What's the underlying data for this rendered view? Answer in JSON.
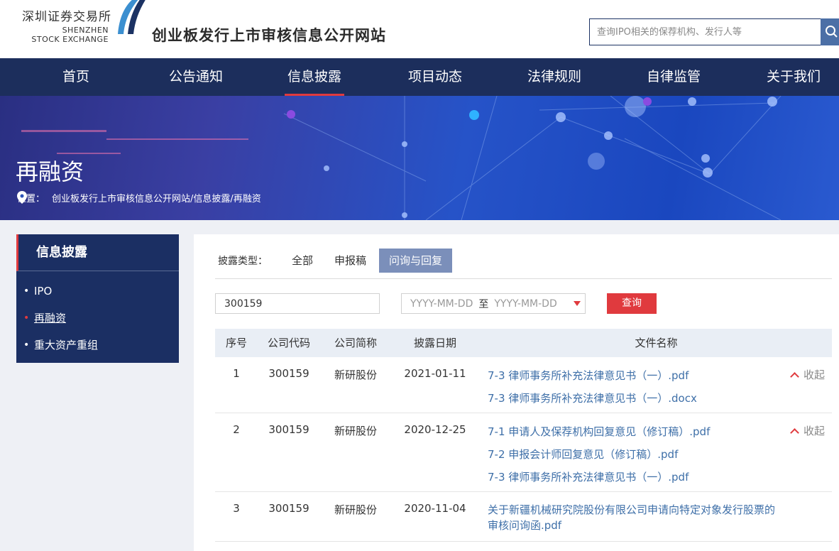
{
  "header": {
    "logo_cn": "深圳证券交易所",
    "logo_en_line1": "SHENZHEN",
    "logo_en_line2": "STOCK EXCHANGE",
    "site_title": "创业板发行上市审核信息公开网站",
    "search_placeholder": "查询IPO相关的保荐机构、发行人等",
    "search_icon": "search-icon"
  },
  "nav": {
    "items": [
      "首页",
      "公告通知",
      "信息披露",
      "项目动态",
      "法律规则",
      "自律监管",
      "关于我们"
    ],
    "active": "信息披露"
  },
  "banner": {
    "title": "再融资",
    "location_label": "位置：",
    "path": "创业板发行上市审核信息公开网站/信息披露/再融资"
  },
  "sidebar": {
    "title": "信息披露",
    "items": [
      "IPO",
      "再融资",
      "重大资产重组"
    ],
    "active": "再融资"
  },
  "filter": {
    "label": "披露类型：",
    "tabs": [
      "全部",
      "申报稿",
      "问询与回复"
    ],
    "active": "问询与回复",
    "code_value": "300159",
    "date_start_placeholder": "YYYY-MM-DD",
    "date_sep": "至",
    "date_end_placeholder": "YYYY-MM-DD",
    "query_label": "查询"
  },
  "table": {
    "headers": [
      "序号",
      "公司代码",
      "公司简称",
      "披露日期",
      "文件名称"
    ],
    "collapse_label": "收起",
    "rows": [
      {
        "no": "1",
        "code": "300159",
        "name": "新研股份",
        "date": "2021-01-11",
        "files": [
          "7-3 律师事务所补充法律意见书（一）.pdf",
          "7-3 律师事务所补充法律意见书（一）.docx"
        ],
        "collapsible": true
      },
      {
        "no": "2",
        "code": "300159",
        "name": "新研股份",
        "date": "2020-12-25",
        "files": [
          "7-1 申请人及保荐机构回复意见（修订稿）.pdf",
          "7-2 申报会计师回复意见（修订稿）.pdf",
          "7-3 律师事务所补充法律意见书（一）.pdf"
        ],
        "collapsible": true
      },
      {
        "no": "3",
        "code": "300159",
        "name": "新研股份",
        "date": "2020-11-04",
        "files": [
          "关于新疆机械研究院股份有限公司申请向特定对象发行股票的审核问询函.pdf"
        ],
        "collapsible": false
      }
    ]
  },
  "colors": {
    "nav_bg": "#1c2e5c",
    "accent_red": "#e03a3e",
    "link_blue": "#3e6fa8",
    "active_tab": "#7b8fba"
  }
}
